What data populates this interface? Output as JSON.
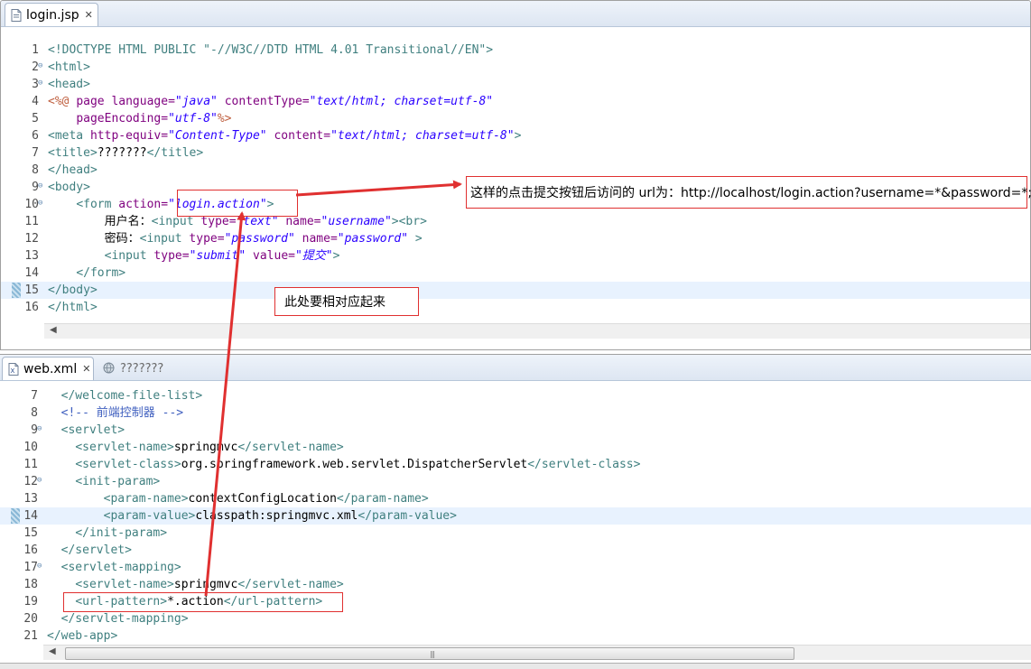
{
  "editor_top": {
    "tab_label": "login.jsp",
    "lines": [
      {
        "n": "1",
        "fold": false,
        "current": false,
        "parts": [
          [
            "d",
            "<!DOCTYPE HTML PUBLIC \"-//W3C//DTD HTML 4.01 Transitional//EN\">"
          ]
        ]
      },
      {
        "n": "2",
        "fold": true,
        "current": false,
        "parts": [
          [
            "t",
            "<html>"
          ]
        ]
      },
      {
        "n": "3",
        "fold": true,
        "current": false,
        "parts": [
          [
            "t",
            "<head>"
          ]
        ]
      },
      {
        "n": "4",
        "fold": false,
        "current": false,
        "parts": [
          [
            "p",
            "<%@ "
          ],
          [
            "a",
            "page "
          ],
          [
            "a",
            "language="
          ],
          [
            "v",
            "\"java\" "
          ],
          [
            "a",
            "contentType="
          ],
          [
            "v",
            "\"text/html; charset=utf-8\""
          ]
        ]
      },
      {
        "n": "5",
        "fold": false,
        "current": false,
        "parts": [
          [
            "tx",
            "    "
          ],
          [
            "a",
            "pageEncoding="
          ],
          [
            "v",
            "\"utf-8\""
          ],
          [
            "p",
            "%>"
          ]
        ]
      },
      {
        "n": "6",
        "fold": false,
        "current": false,
        "parts": [
          [
            "t",
            "<meta "
          ],
          [
            "a",
            "http-equiv="
          ],
          [
            "v",
            "\"Content-Type\" "
          ],
          [
            "a",
            "content="
          ],
          [
            "v",
            "\"text/html; charset=utf-8\""
          ],
          [
            "t",
            ">"
          ]
        ]
      },
      {
        "n": "7",
        "fold": false,
        "current": false,
        "parts": [
          [
            "t",
            "<title>"
          ],
          [
            "tx",
            "???????"
          ],
          [
            "t",
            "</title>"
          ]
        ]
      },
      {
        "n": "8",
        "fold": false,
        "current": false,
        "parts": [
          [
            "t",
            "</head>"
          ]
        ]
      },
      {
        "n": "9",
        "fold": true,
        "current": false,
        "parts": [
          [
            "t",
            "<body>"
          ]
        ]
      },
      {
        "n": "10",
        "fold": true,
        "current": false,
        "parts": [
          [
            "tx",
            "    "
          ],
          [
            "t",
            "<form "
          ],
          [
            "a",
            "action="
          ],
          [
            "v",
            "\"login.action\""
          ],
          [
            "t",
            ">"
          ]
        ]
      },
      {
        "n": "11",
        "fold": false,
        "current": false,
        "parts": [
          [
            "tx",
            "        用户名："
          ],
          [
            "t",
            "<input "
          ],
          [
            "a",
            "type="
          ],
          [
            "v",
            "\"text\" "
          ],
          [
            "a",
            "name="
          ],
          [
            "v",
            "\"username\""
          ],
          [
            "t",
            "><br>"
          ]
        ]
      },
      {
        "n": "12",
        "fold": false,
        "current": false,
        "parts": [
          [
            "tx",
            "        密码："
          ],
          [
            "t",
            "<input "
          ],
          [
            "a",
            "type="
          ],
          [
            "v",
            "\"password\" "
          ],
          [
            "a",
            "name="
          ],
          [
            "v",
            "\"password\" "
          ],
          [
            "t",
            ">"
          ]
        ]
      },
      {
        "n": "13",
        "fold": false,
        "current": false,
        "parts": [
          [
            "tx",
            "        "
          ],
          [
            "t",
            "<input "
          ],
          [
            "a",
            "type="
          ],
          [
            "v",
            "\"submit\" "
          ],
          [
            "a",
            "value="
          ],
          [
            "v",
            "\"提交\""
          ],
          [
            "t",
            ">"
          ]
        ]
      },
      {
        "n": "14",
        "fold": false,
        "current": false,
        "parts": [
          [
            "tx",
            "    "
          ],
          [
            "t",
            "</form>"
          ]
        ]
      },
      {
        "n": "15",
        "fold": false,
        "current": true,
        "parts": [
          [
            "t",
            "</body>"
          ]
        ]
      },
      {
        "n": "16",
        "fold": false,
        "current": false,
        "parts": [
          [
            "t",
            "</html>"
          ]
        ]
      }
    ]
  },
  "editor_bottom": {
    "tab_label": "web.xml",
    "tab2_label": "???????",
    "lines": [
      {
        "n": "7",
        "fold": false,
        "current": false,
        "parts": [
          [
            "tx",
            "  "
          ],
          [
            "t",
            "</welcome-file-list>"
          ]
        ]
      },
      {
        "n": "8",
        "fold": false,
        "current": false,
        "parts": [
          [
            "tx",
            "  "
          ],
          [
            "cm",
            "<!-- 前端控制器 -->"
          ]
        ]
      },
      {
        "n": "9",
        "fold": true,
        "current": false,
        "parts": [
          [
            "tx",
            "  "
          ],
          [
            "t",
            "<servlet>"
          ]
        ]
      },
      {
        "n": "10",
        "fold": false,
        "current": false,
        "parts": [
          [
            "tx",
            "    "
          ],
          [
            "t",
            "<servlet-name>"
          ],
          [
            "tx",
            "springmvc"
          ],
          [
            "t",
            "</servlet-name>"
          ]
        ]
      },
      {
        "n": "11",
        "fold": false,
        "current": false,
        "parts": [
          [
            "tx",
            "    "
          ],
          [
            "t",
            "<servlet-class>"
          ],
          [
            "tx",
            "org.springframework.web.servlet.DispatcherServlet"
          ],
          [
            "t",
            "</servlet-class>"
          ]
        ]
      },
      {
        "n": "12",
        "fold": true,
        "current": false,
        "parts": [
          [
            "tx",
            "    "
          ],
          [
            "t",
            "<init-param>"
          ]
        ]
      },
      {
        "n": "13",
        "fold": false,
        "current": false,
        "parts": [
          [
            "tx",
            "        "
          ],
          [
            "t",
            "<param-name>"
          ],
          [
            "tx",
            "contextConfigLocation"
          ],
          [
            "t",
            "</param-name>"
          ]
        ]
      },
      {
        "n": "14",
        "fold": false,
        "current": true,
        "parts": [
          [
            "tx",
            "        "
          ],
          [
            "t",
            "<param-value>"
          ],
          [
            "tx",
            "classpath:springmvc.xml"
          ],
          [
            "t",
            "</param-value>"
          ]
        ]
      },
      {
        "n": "15",
        "fold": false,
        "current": false,
        "parts": [
          [
            "tx",
            "    "
          ],
          [
            "t",
            "</init-param>"
          ]
        ]
      },
      {
        "n": "16",
        "fold": false,
        "current": false,
        "parts": [
          [
            "tx",
            "  "
          ],
          [
            "t",
            "</servlet>"
          ]
        ]
      },
      {
        "n": "17",
        "fold": true,
        "current": false,
        "parts": [
          [
            "tx",
            "  "
          ],
          [
            "t",
            "<servlet-mapping>"
          ]
        ]
      },
      {
        "n": "18",
        "fold": false,
        "current": false,
        "parts": [
          [
            "tx",
            "    "
          ],
          [
            "t",
            "<servlet-name>"
          ],
          [
            "tx",
            "springmvc"
          ],
          [
            "t",
            "</servlet-name>"
          ]
        ]
      },
      {
        "n": "19",
        "fold": false,
        "current": false,
        "parts": [
          [
            "tx",
            "    "
          ],
          [
            "t",
            "<url-pattern>"
          ],
          [
            "tx",
            "*.action"
          ],
          [
            "t",
            "</url-pattern>"
          ]
        ]
      },
      {
        "n": "20",
        "fold": false,
        "current": false,
        "parts": [
          [
            "tx",
            "  "
          ],
          [
            "t",
            "</servlet-mapping>"
          ]
        ]
      },
      {
        "n": "21",
        "fold": false,
        "current": false,
        "parts": [
          [
            "t",
            "</web-app>"
          ]
        ]
      }
    ]
  },
  "annotations": {
    "url_note": "这样的点击提交按钮后访问的 url为：http://localhost/login.action?username=*&password=*;",
    "match_note": "此处要相对应起来"
  },
  "colors": {
    "annotation_red": "#e03030",
    "tag": "#3f7f7f",
    "attribute": "#7f007f",
    "value": "#2a00ff"
  }
}
